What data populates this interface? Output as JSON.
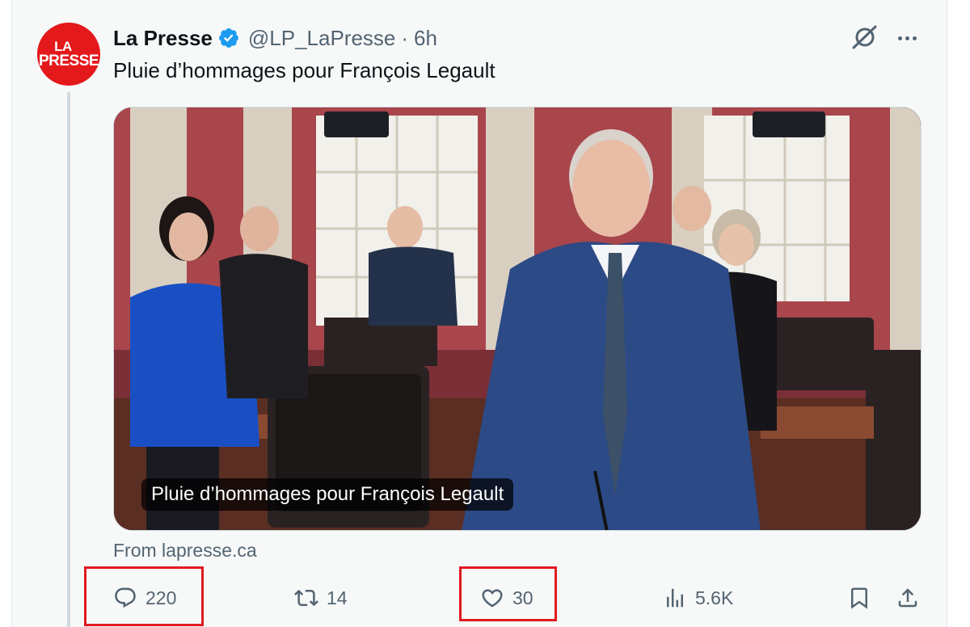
{
  "tweet": {
    "display_name": "La Presse",
    "handle": "@LP_LaPresse",
    "separator": "·",
    "time": "6h",
    "text": "Pluie d’hommages pour François Legault",
    "avatar_text_line1": "LA",
    "avatar_text_line2": "PRESSE",
    "verified": true
  },
  "media": {
    "caption": "Pluie d’hommages pour François Legault",
    "source": "From lapresse.ca"
  },
  "actions": {
    "reply_count": "220",
    "retweet_count": "14",
    "like_count": "30",
    "view_count": "5.6K"
  },
  "highlighted": [
    "reply",
    "like"
  ],
  "colors": {
    "brand_red": "#e3191b",
    "verified_blue": "#1d9bf0",
    "secondary_text": "#536471",
    "highlight_box": "#e0191f"
  },
  "icons": {
    "verified": "verified-badge-icon",
    "grok": "grok-icon",
    "more": "more-icon",
    "reply": "reply-icon",
    "retweet": "retweet-icon",
    "like": "heart-icon",
    "views": "views-icon",
    "bookmark": "bookmark-icon",
    "share": "share-icon"
  }
}
